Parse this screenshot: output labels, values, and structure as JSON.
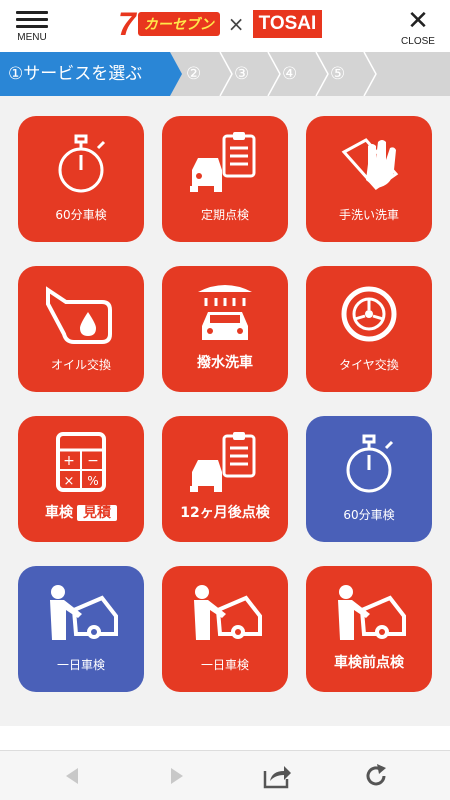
{
  "header": {
    "menu_label": "MENU",
    "close_label": "CLOSE",
    "logo": {
      "seven": "7",
      "carseven": "カーセブン",
      "cross": "×",
      "tosai": "TOSAI"
    }
  },
  "steps": [
    {
      "label": "①サービスを選ぶ",
      "active": true
    },
    {
      "label": "②",
      "active": false
    },
    {
      "label": "③",
      "active": false
    },
    {
      "label": "④",
      "active": false
    },
    {
      "label": "⑤",
      "active": false
    }
  ],
  "tiles": [
    {
      "label": "60分車検",
      "color": "#e53a23",
      "icon": "stopwatch-icon"
    },
    {
      "label": "定期点検",
      "color": "#e53a23",
      "icon": "car-clipboard-icon"
    },
    {
      "label": "手洗い洗車",
      "color": "#e53a23",
      "icon": "hand-wash-icon"
    },
    {
      "label": "オイル交換",
      "color": "#e53a23",
      "icon": "oil-can-icon"
    },
    {
      "label": "撥水洗車",
      "color": "#e53a23",
      "icon": "car-wash-icon"
    },
    {
      "label": "タイヤ交換",
      "color": "#e53a23",
      "icon": "tire-icon"
    },
    {
      "label_a": "車検",
      "label_b": "見積",
      "color": "#e53a23",
      "icon": "calculator-icon"
    },
    {
      "label": "12ヶ月後点検",
      "color": "#e53a23",
      "icon": "car-clipboard-icon"
    },
    {
      "label": "60分車検",
      "color": "#4a60b8",
      "icon": "stopwatch-icon"
    },
    {
      "label": "一日車検",
      "color": "#4a60b8",
      "icon": "mechanic-icon"
    },
    {
      "label": "一日車検",
      "color": "#e53a23",
      "icon": "mechanic-icon"
    },
    {
      "label": "車検前点検",
      "color": "#e53a23",
      "icon": "mechanic-icon"
    }
  ]
}
